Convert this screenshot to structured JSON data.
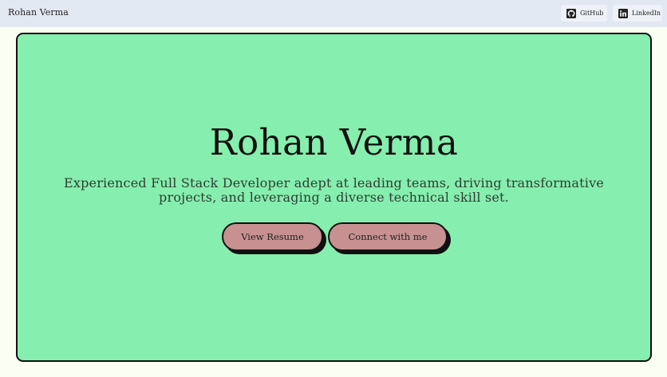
{
  "header": {
    "brand": "Rohan Verma",
    "links": [
      {
        "label": "GitHub",
        "icon": "github-icon"
      },
      {
        "label": "LinkedIn",
        "icon": "linkedin-icon"
      }
    ]
  },
  "hero": {
    "title": "Rohan Verma",
    "subtitle": "Experienced Full Stack Developer adept at leading teams, driving transformative projects, and leveraging a diverse technical skill set.",
    "buttons": {
      "resume": "View Resume",
      "connect": "Connect with me"
    }
  },
  "colors": {
    "page_background": "#fbfff3",
    "header_background": "#e2e8f2",
    "hero_background": "#86eeae",
    "button_background": "#c79191",
    "border": "#111111"
  }
}
